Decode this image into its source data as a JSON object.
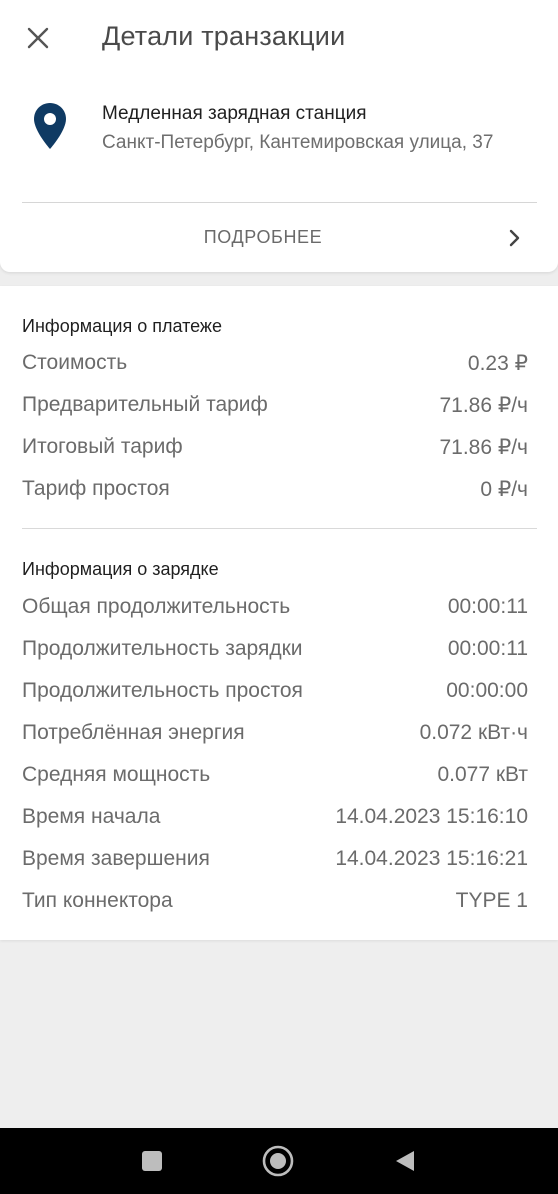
{
  "header": {
    "title": "Детали транзакции",
    "close_icon": "close-icon"
  },
  "station": {
    "icon": "location-pin-icon",
    "icon_color": "#0f3a63",
    "name": "Медленная зарядная станция",
    "address": "Санкт-Петербург, Кантемировская улица, 37"
  },
  "details_link": {
    "label": "ПОДРОБНЕЕ",
    "icon": "chevron-right-icon"
  },
  "payment": {
    "title": "Информация о платеже",
    "rows": [
      {
        "label": "Стоимость",
        "value": "0.23 ₽"
      },
      {
        "label": "Предварительный тариф",
        "value": "71.86 ₽/ч"
      },
      {
        "label": "Итоговый тариф",
        "value": "71.86 ₽/ч"
      },
      {
        "label": "Тариф простоя",
        "value": "0 ₽/ч"
      }
    ]
  },
  "charging": {
    "title": "Информация о зарядке",
    "rows": [
      {
        "label": "Общая продолжительность",
        "value": "00:00:11"
      },
      {
        "label": "Продолжительность зарядки",
        "value": "00:00:11"
      },
      {
        "label": "Продолжительность простоя",
        "value": "00:00:00"
      },
      {
        "label": "Потреблённая энергия",
        "value": "0.072 кВт·ч"
      },
      {
        "label": "Средняя мощность",
        "value": "0.077 кВт"
      },
      {
        "label": "Время начала",
        "value": "14.04.2023 15:16:10"
      },
      {
        "label": "Время завершения",
        "value": "14.04.2023 15:16:21"
      },
      {
        "label": "Тип коннектора",
        "value": "TYPE 1"
      }
    ]
  },
  "navbar": {
    "recents_icon": "recents-square-icon",
    "home_icon": "home-circle-icon",
    "back_icon": "back-triangle-icon"
  }
}
